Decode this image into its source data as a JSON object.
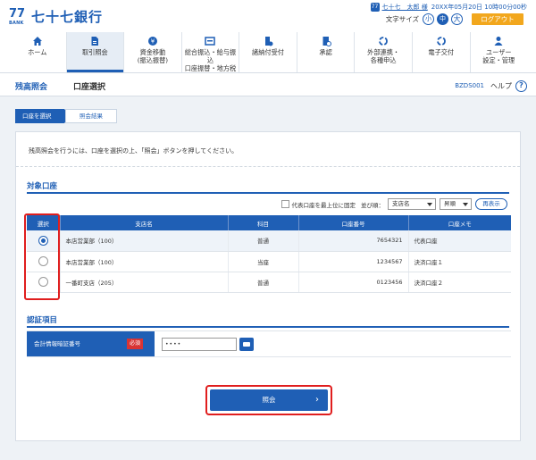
{
  "colors": {
    "brand": "#1f5fb5",
    "accent": "#f2a71d",
    "required": "#d93434",
    "highlight": "#e01e1e"
  },
  "header": {
    "logo_mark": "77",
    "logo_mark_small": "BANK",
    "logo_text": "七十七銀行",
    "user_icon": "77",
    "username": "七十七　太郎 様",
    "last_login": "20XX年05月20日 10時00分00秒",
    "font_size_label": "文字サイズ",
    "font_sizes": [
      "小",
      "中",
      "大"
    ],
    "font_size_selected": "中",
    "logout": "ログアウト"
  },
  "nav": [
    {
      "icon": "home-icon",
      "label": "ホーム"
    },
    {
      "icon": "document-icon",
      "label": "取引照会",
      "active": true
    },
    {
      "icon": "money-transfer-icon",
      "label": "資金移動\n(振込振替)"
    },
    {
      "icon": "batch-transfer-icon",
      "label": "総合振込・給与振込\n口座振替・地方税"
    },
    {
      "icon": "tax-payment-icon",
      "label": "諸納付受付"
    },
    {
      "icon": "approval-icon",
      "label": "承認"
    },
    {
      "icon": "external-link-icon",
      "label": "外部連携・\n各種申込"
    },
    {
      "icon": "e-delivery-icon",
      "label": "電子交付"
    },
    {
      "icon": "user-settings-icon",
      "label": "ユーザー\n設定・管理"
    }
  ],
  "page": {
    "title_main": "残高照会",
    "title_sub": "口座選択",
    "code": "BZDS001",
    "help": "ヘルプ",
    "help_icon_glyph": "?"
  },
  "steps": [
    "口座を選択",
    "照会結果"
  ],
  "instruction": "残高照会を行うには、口座を選択の上、「照会」ボタンを押してください。",
  "accounts_section": {
    "title": "対象口座",
    "pin_representative": "代表口座を最上位に固定",
    "sort_label": "並び順：",
    "sort_field": "支店名",
    "sort_order": "昇順",
    "redisplay": "再表示",
    "columns": [
      "選択",
      "支店名",
      "科目",
      "口座番号",
      "口座メモ"
    ],
    "rows": [
      {
        "selected": true,
        "branch": "本店営業部（100）",
        "item": "普通",
        "number": "7654321",
        "memo": "代表口座"
      },
      {
        "selected": false,
        "branch": "本店営業部（100）",
        "item": "当座",
        "number": "1234567",
        "memo": "決済口座１"
      },
      {
        "selected": false,
        "branch": "一番町支店（205）",
        "item": "普通",
        "number": "0123456",
        "memo": "決済口座２"
      }
    ]
  },
  "auth_section": {
    "title": "認証項目",
    "field_label": "会計情報暗証番号",
    "required": "必須",
    "value": "••••"
  },
  "submit": {
    "label": "照会",
    "chevron": "›"
  }
}
